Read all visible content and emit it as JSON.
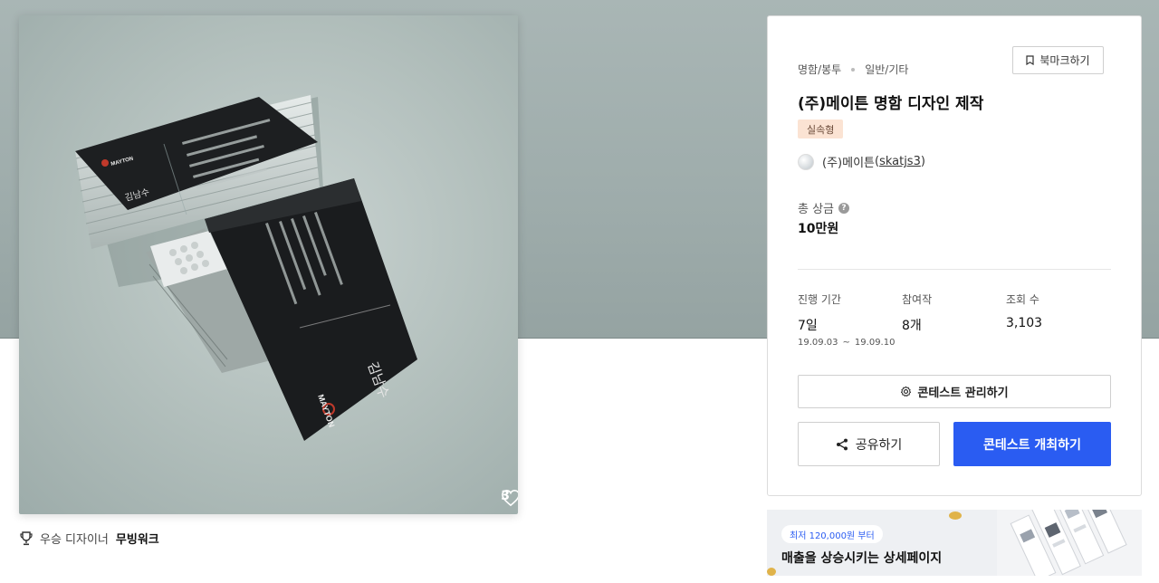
{
  "image": {
    "like_count": "3"
  },
  "designer": {
    "prefix": "우승 디자이너",
    "name": "무빙워크"
  },
  "contest": {
    "category_main": "명함/봉투",
    "category_sub": "일반/기타",
    "bookmark_label": "북마크하기",
    "title": "(주)메이튼 명함 디자인 제작",
    "badge": "실속형",
    "host_name": "(주)메이튼",
    "host_handle": "skatjs3",
    "prize_label": "총 상금",
    "prize_value": "10만원",
    "stats": {
      "period_label": "진행 기간",
      "period_value": "7일",
      "period_start": "19.09.03",
      "period_sep": "~",
      "period_end": "19.09.10",
      "entries_label": "참여작",
      "entries_value": "8개",
      "views_label": "조회 수",
      "views_value": "3,103"
    },
    "manage_label": "콘테스트 관리하기",
    "share_label": "공유하기",
    "host_button_label": "콘테스트 개최하기"
  },
  "ad": {
    "pill": "최저 120,000원 부터",
    "text": "매출을 상승시키는 상세페이지"
  },
  "card_text": {
    "logo": "MAYTON",
    "name": "김남수"
  },
  "colors": {
    "accent": "#2a5cf2",
    "badge_bg": "#fbe3d3",
    "hero_bg": "#9eacab"
  }
}
